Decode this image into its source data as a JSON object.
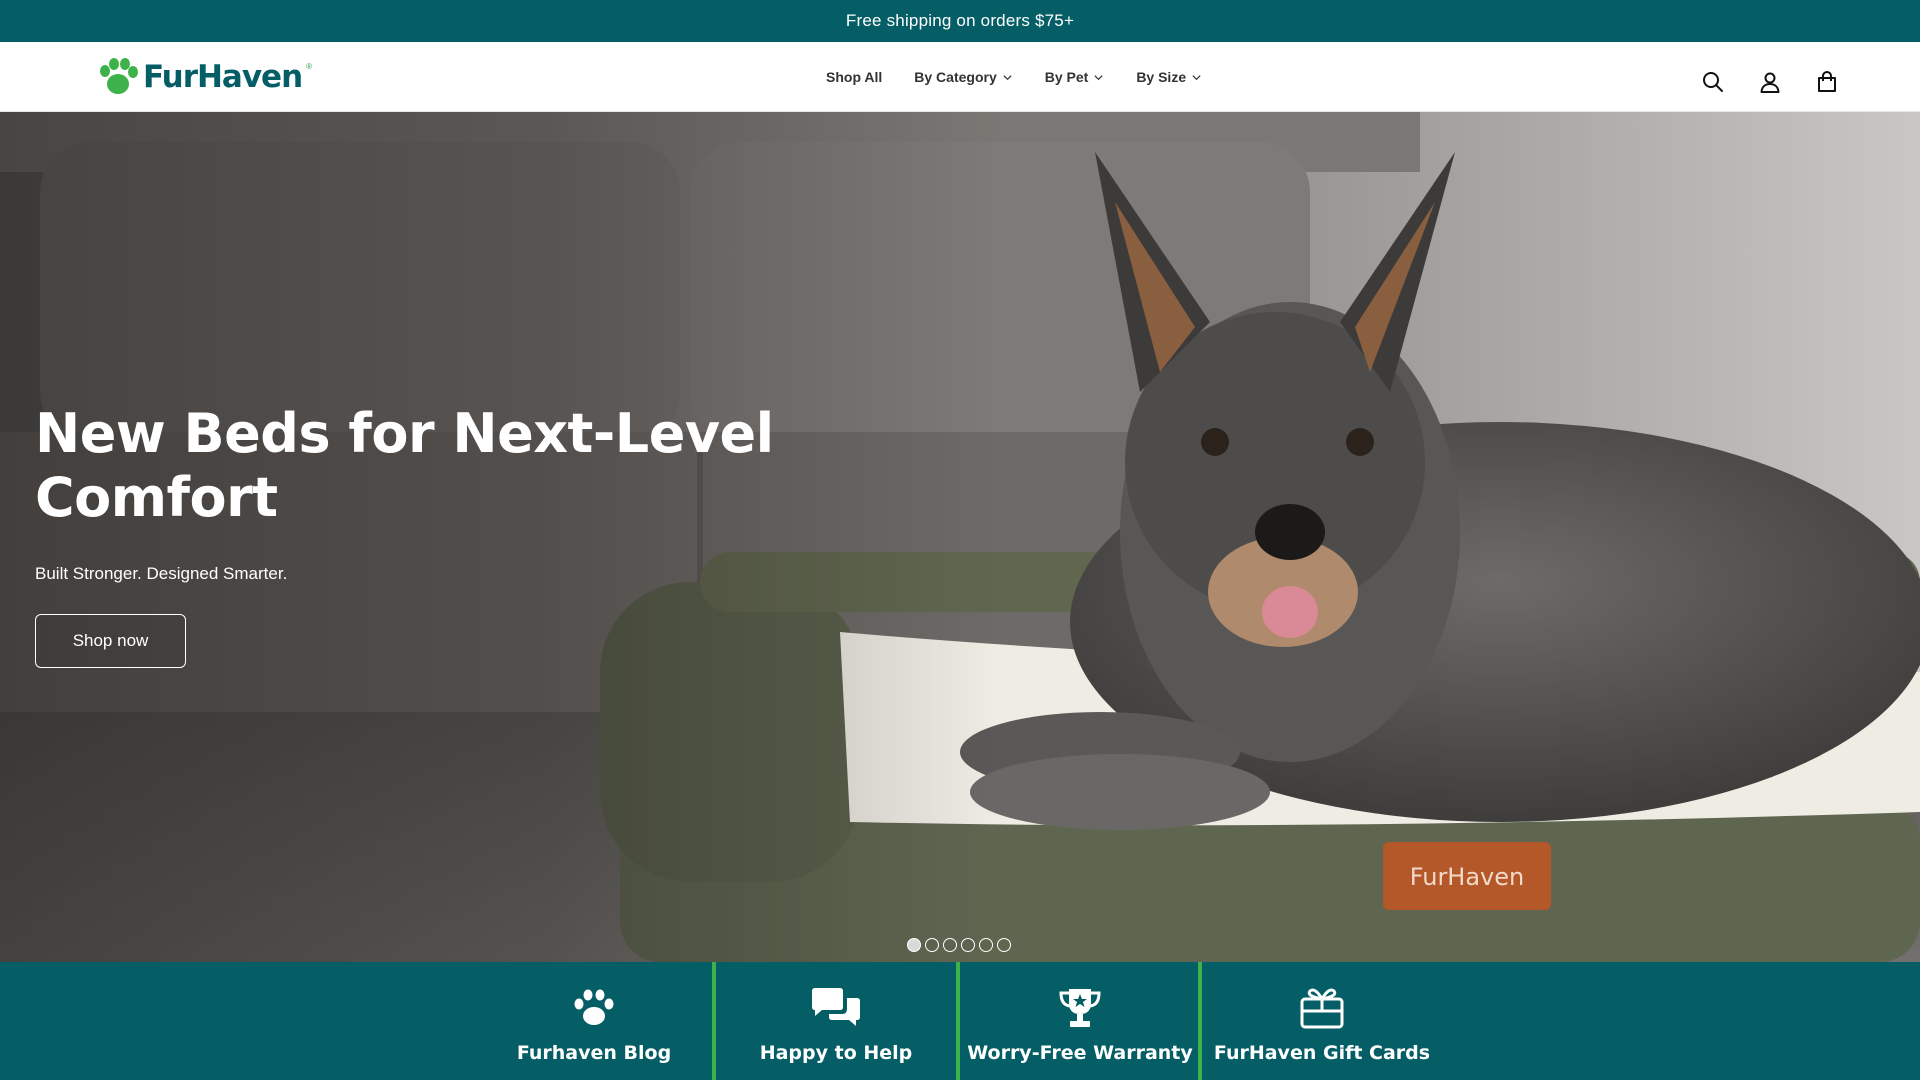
{
  "announcement": {
    "text": "Free shipping on orders $75+"
  },
  "header": {
    "logo": {
      "text": "FurHaven",
      "reg": "®"
    },
    "nav": [
      {
        "label": "Shop All",
        "has_dropdown": false
      },
      {
        "label": "By Category",
        "has_dropdown": true
      },
      {
        "label": "By Pet",
        "has_dropdown": true
      },
      {
        "label": "By Size",
        "has_dropdown": true
      }
    ],
    "icons": [
      "search-icon",
      "account-icon",
      "cart-icon"
    ]
  },
  "hero": {
    "title_line1": "New Beds for Next-Level",
    "title_line2": "Comfort",
    "subtitle": "Built Stronger. Designed Smarter.",
    "cta_label": "Shop now",
    "bed_tag": "FurHaven",
    "slides_total": 6,
    "active_slide": 1
  },
  "features": [
    {
      "label": "Furhaven Blog",
      "icon": "paw-icon"
    },
    {
      "label": "Happy to Help",
      "icon": "chat-icon"
    },
    {
      "label": "Worry-Free Warranty",
      "icon": "trophy-icon"
    },
    {
      "label": "FurHaven Gift Cards",
      "icon": "gift-icon"
    }
  ],
  "colors": {
    "brand_teal": "#055e65",
    "brand_green": "#3db24a",
    "white": "#ffffff"
  }
}
